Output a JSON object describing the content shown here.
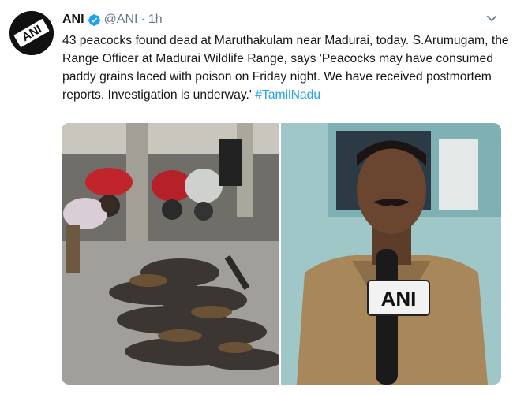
{
  "tweet": {
    "author_name": "ANI",
    "handle": "@ANI",
    "separator": "·",
    "time": "1h",
    "text_lines": [
      "43 peacocks found dead at Maruthakulam near Madurai, today. S.Arumugam, the",
      "Range Officer at Madurai Wildlife Range, says 'Peacocks may have consumed",
      "paddy grains laced with poison on Friday night. We have received postmortem",
      "reports. Investigation is underway.' "
    ],
    "hashtag": "#TamilNadu",
    "avatar_logo": "ANI",
    "mic_label": "ANI"
  },
  "colors": {
    "link": "#1da1f2",
    "verified": "#1da1f2",
    "muted": "#657786",
    "text": "#14171a"
  },
  "icons": {
    "verified": "verified-badge-icon",
    "menu": "chevron-down-icon"
  }
}
